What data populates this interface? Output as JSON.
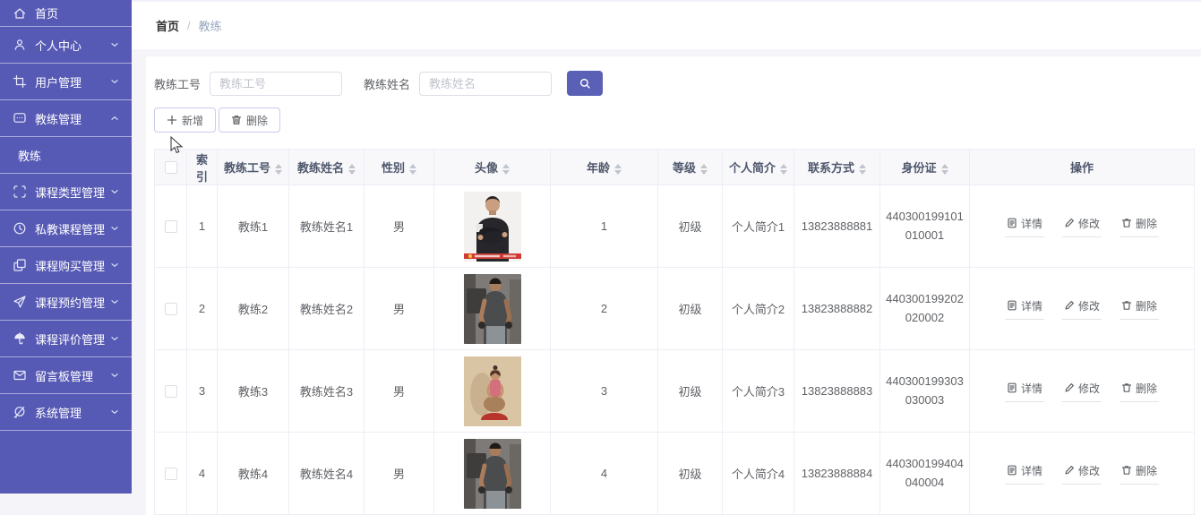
{
  "colors": {
    "sidebar_bg": "#575ab5",
    "primary": "#5a60b5",
    "table_border": "#ebeef5"
  },
  "sidebar": {
    "items": [
      {
        "label": "首页",
        "icon": "home-icon"
      },
      {
        "label": "个人中心",
        "icon": "user-icon",
        "chevron": "down"
      },
      {
        "label": "用户管理",
        "icon": "crop-icon",
        "chevron": "down"
      },
      {
        "label": "教练管理",
        "icon": "chat-icon",
        "chevron": "up",
        "expanded": true
      },
      {
        "label": "教练",
        "type": "subitem",
        "active": true
      },
      {
        "label": "课程类型管理",
        "icon": "scan-icon",
        "chevron": "down"
      },
      {
        "label": "私教课程管理",
        "icon": "clock-icon",
        "chevron": "down"
      },
      {
        "label": "课程购买管理",
        "icon": "copy-icon",
        "chevron": "down"
      },
      {
        "label": "课程预约管理",
        "icon": "paper-plane-icon",
        "chevron": "down"
      },
      {
        "label": "课程评价管理",
        "icon": "umbrella-icon",
        "chevron": "down"
      },
      {
        "label": "留言板管理",
        "icon": "mail-icon",
        "chevron": "down"
      },
      {
        "label": "系统管理",
        "icon": "slashed-circle-icon",
        "chevron": "down"
      }
    ]
  },
  "breadcrumb": {
    "home": "首页",
    "separator": "/",
    "current": "教练"
  },
  "search": {
    "coach_id_label": "教练工号",
    "coach_id_placeholder": "教练工号",
    "coach_id_value": "",
    "coach_name_label": "教练姓名",
    "coach_name_placeholder": "教练姓名",
    "coach_name_value": ""
  },
  "toolbar": {
    "add_label": "新增",
    "delete_label": "删除"
  },
  "table": {
    "headers": {
      "index": "索引",
      "coach_id": "教练工号",
      "coach_name": "教练姓名",
      "gender": "性别",
      "avatar": "头像",
      "age": "年龄",
      "level": "等级",
      "intro": "个人简介",
      "contact": "联系方式",
      "id_card": "身份证",
      "actions": "操作"
    },
    "action_labels": {
      "detail": "详情",
      "edit": "修改",
      "delete": "删除"
    },
    "rows": [
      {
        "index": "1",
        "coach_id": "教练1",
        "coach_name": "教练姓名1",
        "gender": "男",
        "age": "1",
        "level": "初级",
        "intro": "个人简介1",
        "contact": "13823888881",
        "id_card": "440300199101010001",
        "avatar": "male-coach-arms-crossed-photo"
      },
      {
        "index": "2",
        "coach_id": "教练2",
        "coach_name": "教练姓名2",
        "gender": "男",
        "age": "2",
        "level": "初级",
        "intro": "个人简介2",
        "contact": "13823888882",
        "id_card": "440300199202020002",
        "avatar": "male-coach-gym-photo"
      },
      {
        "index": "3",
        "coach_id": "教练3",
        "coach_name": "教练姓名3",
        "gender": "男",
        "age": "3",
        "level": "初级",
        "intro": "个人简介3",
        "contact": "13823888883",
        "id_card": "440300199303030003",
        "avatar": "female-coach-yoga-photo"
      },
      {
        "index": "4",
        "coach_id": "教练4",
        "coach_name": "教练姓名4",
        "gender": "男",
        "age": "4",
        "level": "初级",
        "intro": "个人简介4",
        "contact": "13823888884",
        "id_card": "440300199404040004",
        "avatar": "male-coach-gym-photo"
      }
    ]
  }
}
